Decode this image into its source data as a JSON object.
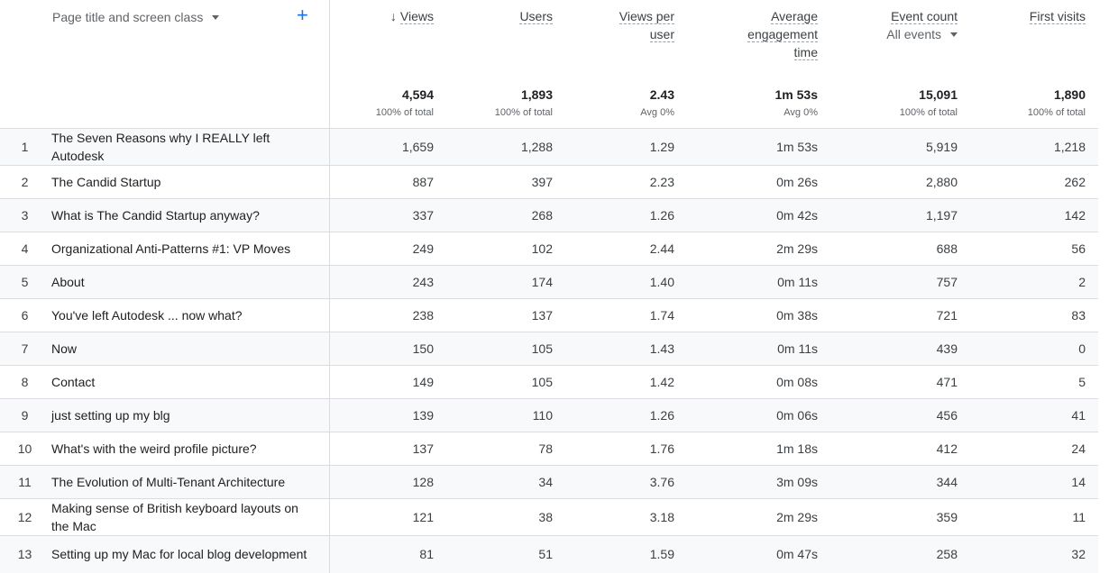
{
  "dimension": {
    "label": "Page title and screen class",
    "add": "+"
  },
  "columns": [
    {
      "key": "views",
      "label": "Views",
      "sorted": true
    },
    {
      "key": "users",
      "label": "Users"
    },
    {
      "key": "vpu",
      "label": "Views per user"
    },
    {
      "key": "eng",
      "label": "Average engagement time"
    },
    {
      "key": "evt",
      "label": "Event count",
      "sub": "All events"
    },
    {
      "key": "first",
      "label": "First visits"
    }
  ],
  "totals": [
    {
      "value": "4,594",
      "sub": "100% of total"
    },
    {
      "value": "1,893",
      "sub": "100% of total"
    },
    {
      "value": "2.43",
      "sub": "Avg 0%"
    },
    {
      "value": "1m 53s",
      "sub": "Avg 0%"
    },
    {
      "value": "15,091",
      "sub": "100% of total"
    },
    {
      "value": "1,890",
      "sub": "100% of total"
    }
  ],
  "rows": [
    {
      "idx": "1",
      "title": "The Seven Reasons why I REALLY left Autodesk",
      "views": "1,659",
      "users": "1,288",
      "vpu": "1.29",
      "eng": "1m 53s",
      "evt": "5,919",
      "first": "1,218"
    },
    {
      "idx": "2",
      "title": "The Candid Startup",
      "views": "887",
      "users": "397",
      "vpu": "2.23",
      "eng": "0m 26s",
      "evt": "2,880",
      "first": "262"
    },
    {
      "idx": "3",
      "title": "What is The Candid Startup anyway?",
      "views": "337",
      "users": "268",
      "vpu": "1.26",
      "eng": "0m 42s",
      "evt": "1,197",
      "first": "142"
    },
    {
      "idx": "4",
      "title": "Organizational Anti-Patterns #1: VP Moves",
      "views": "249",
      "users": "102",
      "vpu": "2.44",
      "eng": "2m 29s",
      "evt": "688",
      "first": "56"
    },
    {
      "idx": "5",
      "title": "About",
      "views": "243",
      "users": "174",
      "vpu": "1.40",
      "eng": "0m 11s",
      "evt": "757",
      "first": "2"
    },
    {
      "idx": "6",
      "title": "You've left Autodesk ... now what?",
      "views": "238",
      "users": "137",
      "vpu": "1.74",
      "eng": "0m 38s",
      "evt": "721",
      "first": "83"
    },
    {
      "idx": "7",
      "title": "Now",
      "views": "150",
      "users": "105",
      "vpu": "1.43",
      "eng": "0m 11s",
      "evt": "439",
      "first": "0"
    },
    {
      "idx": "8",
      "title": "Contact",
      "views": "149",
      "users": "105",
      "vpu": "1.42",
      "eng": "0m 08s",
      "evt": "471",
      "first": "5"
    },
    {
      "idx": "9",
      "title": "just setting up my blg",
      "views": "139",
      "users": "110",
      "vpu": "1.26",
      "eng": "0m 06s",
      "evt": "456",
      "first": "41"
    },
    {
      "idx": "10",
      "title": "What's with the weird profile picture?",
      "views": "137",
      "users": "78",
      "vpu": "1.76",
      "eng": "1m 18s",
      "evt": "412",
      "first": "24"
    },
    {
      "idx": "11",
      "title": "The Evolution of Multi-Tenant Architecture",
      "views": "128",
      "users": "34",
      "vpu": "3.76",
      "eng": "3m 09s",
      "evt": "344",
      "first": "14"
    },
    {
      "idx": "12",
      "title": "Making sense of British keyboard layouts on the Mac",
      "views": "121",
      "users": "38",
      "vpu": "3.18",
      "eng": "2m 29s",
      "evt": "359",
      "first": "11"
    },
    {
      "idx": "13",
      "title": "Setting up my Mac for local blog development",
      "views": "81",
      "users": "51",
      "vpu": "1.59",
      "eng": "0m 47s",
      "evt": "258",
      "first": "32"
    }
  ]
}
